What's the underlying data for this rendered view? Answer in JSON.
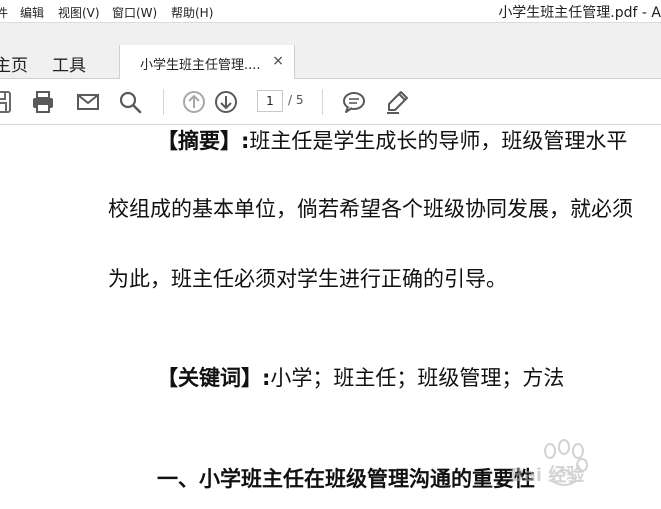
{
  "menubar": {
    "items": [
      "件",
      "编辑",
      "视图(V)",
      "窗口(W)",
      "帮助(H)"
    ],
    "window_title": "小学生班主任管理.pdf - A"
  },
  "tabs": {
    "home": "主页",
    "tools": "工具",
    "document_tab": "小学生班主任管理....",
    "close_symbol": "×"
  },
  "toolbar": {
    "page_current": "1",
    "page_total": "/ 5",
    "icons": [
      "save-icon",
      "print-icon",
      "email-icon",
      "search-icon",
      "page-up-icon",
      "page-down-icon",
      "comment-icon",
      "highlight-pen-icon"
    ]
  },
  "document": {
    "abstract_label": "【摘要】:",
    "abstract_text": "班主任是学生成长的导师，班级管理水平",
    "line2": "校组成的基本单位，倘若希望各个班级协同发展，就必须",
    "line3": "为此，班主任必须对学生进行正确的引导。",
    "keywords_label": "【关键词】:",
    "keywords_text": "小学；班主任；班级管理；方法",
    "heading1": "一、小学班主任在班级管理沟通的重要性"
  },
  "watermark": {
    "text": "Bai 经验"
  },
  "colors": {
    "tabbar_bg": "#f0f0f0",
    "icon_gray": "#6a6a6a",
    "text": "#111111"
  }
}
